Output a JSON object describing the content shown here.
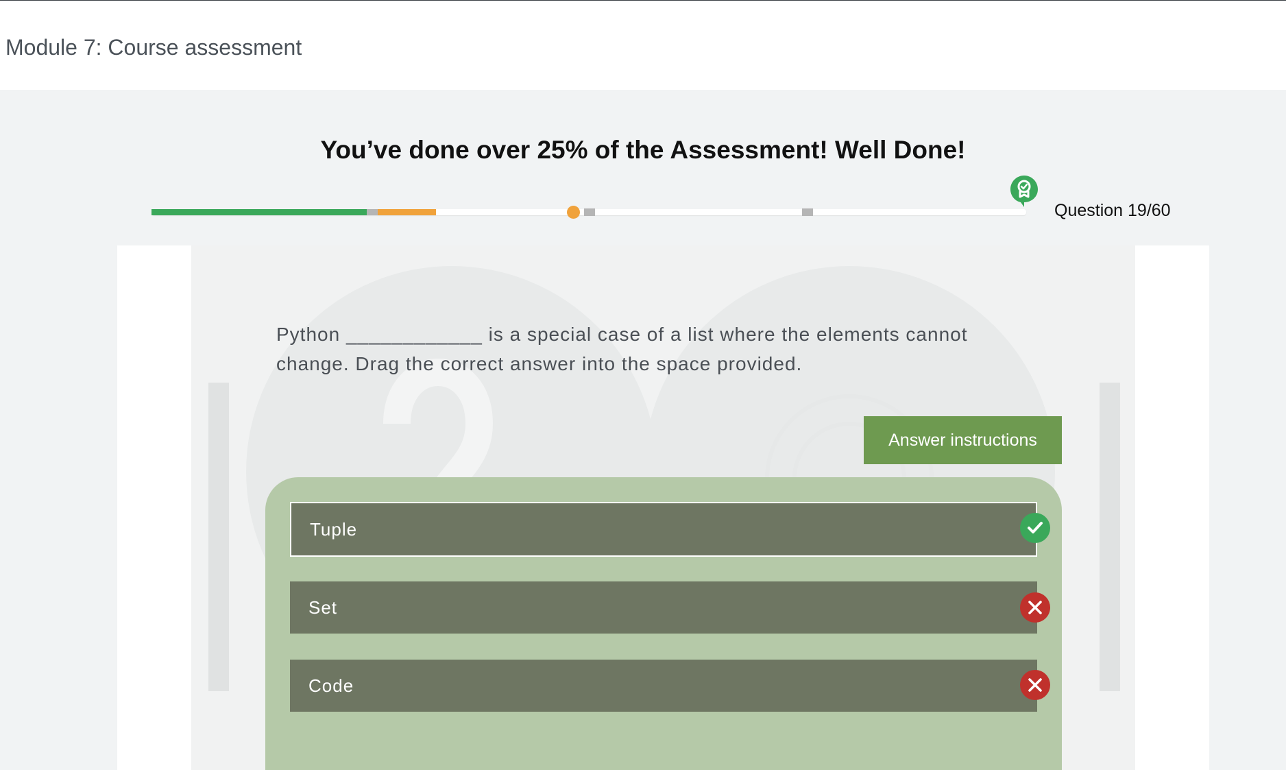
{
  "header": {
    "module_title": "Module 7: Course assessment"
  },
  "banner": {
    "text": "You’ve done over 25% of the Assessment! Well Done!"
  },
  "progress": {
    "completed_fraction": 0.25,
    "current_fraction": 0.315,
    "counter_text": "Question 19/60",
    "colors": {
      "completed": "#3aa85a",
      "current": "#f0a23b",
      "track": "#ffffff",
      "milestone": "#b5b5b5"
    }
  },
  "question": {
    "text": "Python ____________ is a special case of a list where the elements cannot change. Drag the correct answer into the space provided."
  },
  "answer_instructions_label": "Answer instructions",
  "options": [
    {
      "label": "Tuple",
      "status": "correct"
    },
    {
      "label": "Set",
      "status": "incorrect"
    },
    {
      "label": "Code",
      "status": "incorrect"
    }
  ],
  "icons": {
    "milestone_badge": "award-badge-icon",
    "correct": "checkmark-icon",
    "incorrect": "cross-icon"
  }
}
